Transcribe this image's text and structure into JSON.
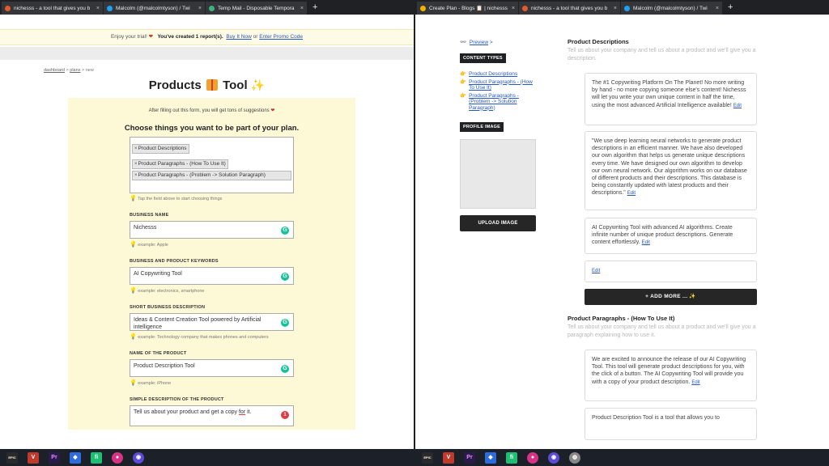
{
  "left_tabs": [
    {
      "title": "nichesss - a tool that gives you b",
      "color": "#e25b2c"
    },
    {
      "title": "Malcolm (@malcolmtyson) / Twi",
      "color": "#1da1f2"
    },
    {
      "title": "Temp Mail - Disposable Tempora",
      "color": "#3fb37f"
    }
  ],
  "right_tabs": [
    {
      "title": "Create Plan - Blogs 📋 | nichesss",
      "color": "#f0b400"
    },
    {
      "title": "nichesss - a tool that gives you b",
      "color": "#e25b2c"
    },
    {
      "title": "Malcolm (@malcolmtyson) / Twi",
      "color": "#1da1f2"
    }
  ],
  "new_tab": "+",
  "close_glyph": "×",
  "trial": {
    "prefix": "Enjoy your trial!",
    "bold": "You've created 1 report(s).",
    "buy": "Buy It Now",
    "or": "or",
    "promo": "Enter Promo Code"
  },
  "breadcrumb": {
    "dashboard": "dashboard",
    "sep1": " > ",
    "plans": "plans",
    "sep2": " > ",
    "current": "new"
  },
  "page": {
    "title_a": "Products",
    "title_b": "Tool"
  },
  "form": {
    "hint_top": "After filling out this form, you will get tons of suggestions",
    "choose_heading": "Choose things you want to be part of your plan.",
    "chips": [
      "Product Descriptions",
      "Product Paragraphs - (How To Use It)",
      "Product Paragraphs - (Problem -> Solution Paragraph)"
    ],
    "chip_x": "×",
    "choose_tip": "Tap the field above to start choosing things",
    "fields": [
      {
        "label": "BUSINESS NAME",
        "value": "Nichesss",
        "example": "example: Apple"
      },
      {
        "label": "BUSINESS AND PRODUCT KEYWORDS",
        "value": "AI Copywriting Tool",
        "example": "example: electronics, smartphone"
      },
      {
        "label": "SHORT BUSINESS DESCRIPTION",
        "value": "Ideas & Content Creation Tool powered by Artificial intelligence",
        "example": "example: Technology company that makes phones and computers"
      },
      {
        "label": "NAME OF THE PRODUCT",
        "value": "Product Description Tool",
        "example": "example: iPhone"
      },
      {
        "label": "SIMPLE DESCRIPTION OF THE PRODUCT",
        "value_a": "Tell us about your product and get a copy ",
        "value_b": "for",
        "value_c": " it."
      }
    ],
    "grammarly_glyph": "G",
    "grammarly_count": "1"
  },
  "right": {
    "preview": "Preview",
    "preview_arrow": " >",
    "content_types_btn": "CONTENT TYPES",
    "content_types": [
      "Product Descriptions",
      "Product Paragraphs - (How To Use It)",
      "Product Paragraphs - (Problem -> Solution Paragraph)"
    ],
    "profile_image_btn": "PROFILE IMAGE",
    "upload_btn": "UPLOAD IMAGE",
    "sections": [
      {
        "heading": "Product Descriptions",
        "sub": "Tell us about your company and tell us about a product and we'll give you a description.",
        "cards": [
          "The #1 Copywriting Platform On The Planet! No more writing by hand - no more copying someone else's content! Nichesss will let you write your own unique content in half the time, using the most advanced Artificial Intelligence available!",
          "\"We use deep learning neural networks to generate product descriptions in an efficient manner. We have also developed our own algorithm that helps us generate unique descriptions every time. We have designed our own algorithm to develop our own neural network. Our algorithm works on our database of different products and their descriptions. This database is being constantly updated with latest products and their descriptions.\"",
          "AI Copywriting Tool with advanced AI algorithms. Create infinite number of unique product descriptions. Generate content effortlessly.",
          ""
        ],
        "edit": "Edit",
        "add_more": "+ ADD MORE ... ✨"
      },
      {
        "heading": "Product Paragraphs - (How To Use It)",
        "sub": "Tell us about your company and tell us about a product and we'll give you a paragraph explaining how to use it.",
        "cards": [
          "We are excited to announce the release of our AI Copywriting Tool. This tool will generate product descriptions for you, with the click of a button. The AI Copywriting Tool will provide you with a copy of your product description.",
          "Product Description Tool is a tool that allows you to"
        ],
        "edit": "Edit"
      }
    ]
  },
  "taskbar_left": [
    {
      "name": "epic-games-icon",
      "glyph": "EPIC",
      "color": "#2a2a2a"
    },
    {
      "name": "vivaldi-icon",
      "glyph": "V",
      "color": "#c0392b"
    },
    {
      "name": "premiere-icon",
      "glyph": "Pr",
      "color": "#2b1b4a"
    },
    {
      "name": "shield-icon",
      "glyph": "◆",
      "color": "#2d6cdf"
    },
    {
      "name": "fiverr-icon",
      "glyph": "fi",
      "color": "#1dbf73"
    },
    {
      "name": "music-icon",
      "glyph": "●",
      "color": "#d63384"
    },
    {
      "name": "unknown-icon",
      "glyph": "◉",
      "color": "#5b4bd6"
    }
  ],
  "taskbar_right": [
    {
      "name": "epic-games-icon",
      "glyph": "EPIC",
      "color": "#2a2a2a"
    },
    {
      "name": "vivaldi-icon",
      "glyph": "V",
      "color": "#c0392b"
    },
    {
      "name": "premiere-icon",
      "glyph": "Pr",
      "color": "#2b1b4a"
    },
    {
      "name": "shield-icon",
      "glyph": "◆",
      "color": "#2d6cdf"
    },
    {
      "name": "fiverr-icon",
      "glyph": "fi",
      "color": "#1dbf73"
    },
    {
      "name": "music-icon",
      "glyph": "●",
      "color": "#d63384"
    },
    {
      "name": "unknown-icon",
      "glyph": "◉",
      "color": "#5b4bd6"
    },
    {
      "name": "browser-icon",
      "glyph": "◍",
      "color": "#888888"
    }
  ]
}
